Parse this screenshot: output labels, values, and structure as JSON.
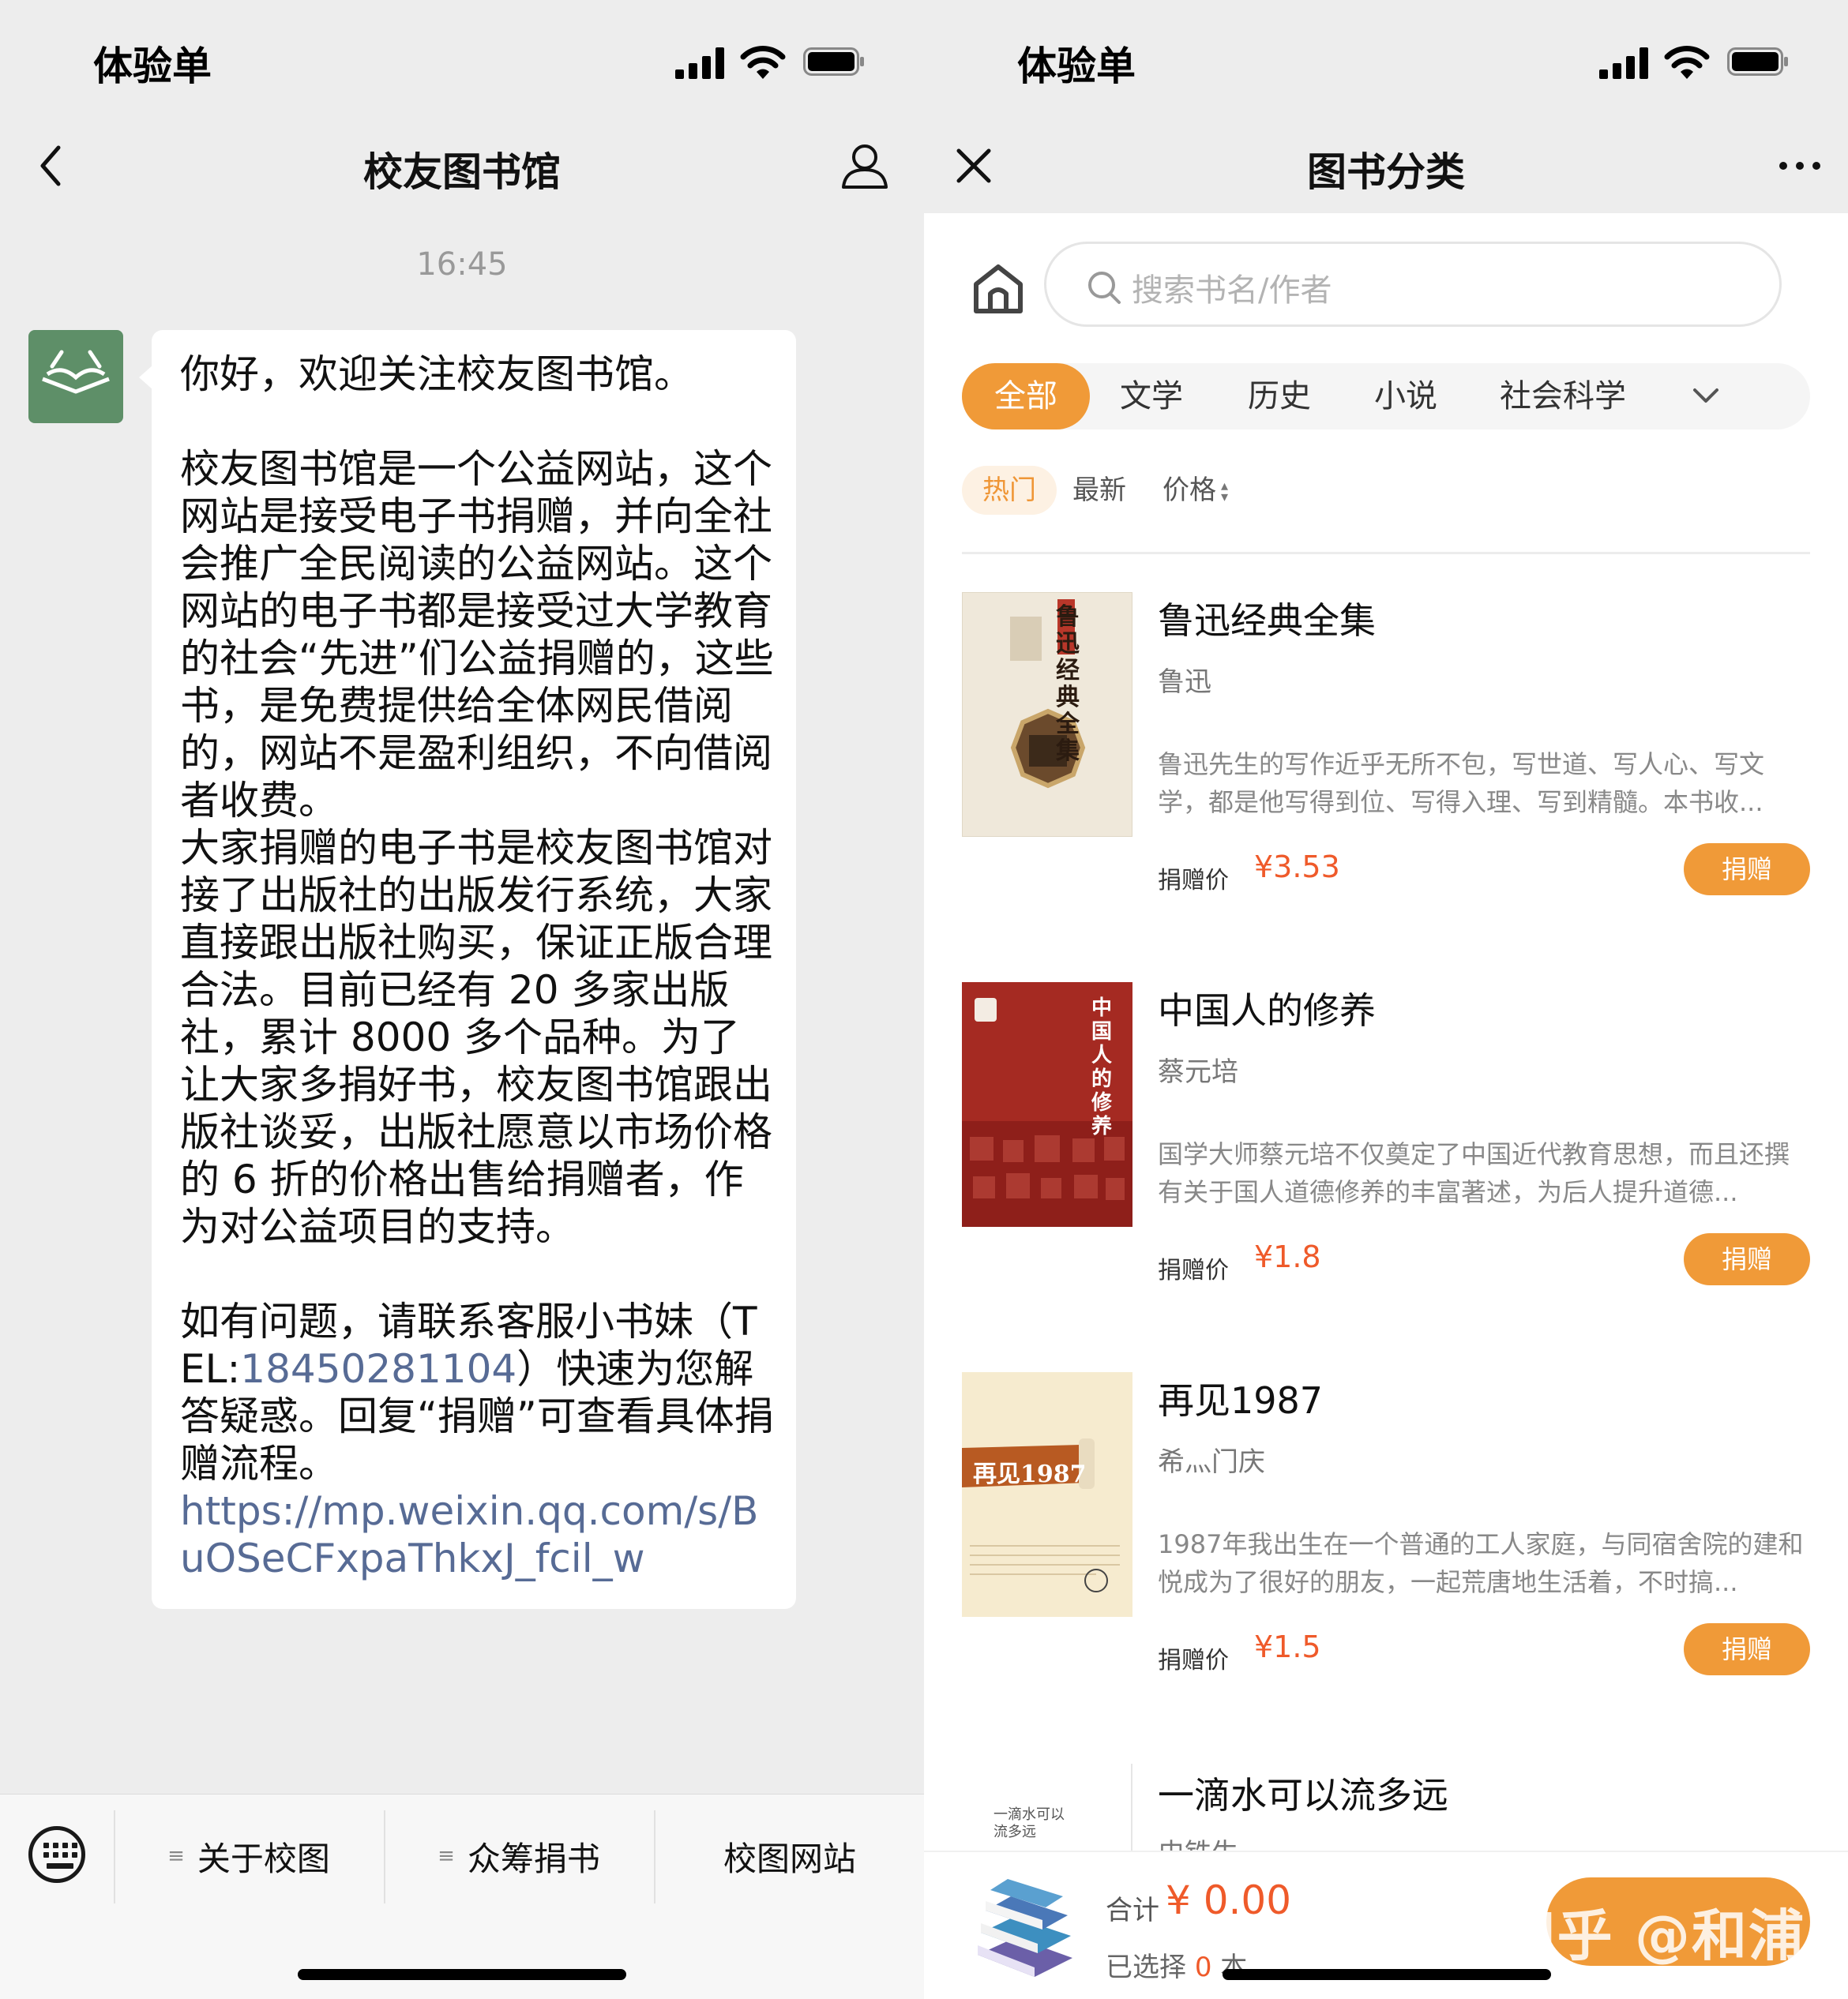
{
  "left": {
    "status": {
      "carrier": "体验单"
    },
    "nav": {
      "title": "校友图书馆"
    },
    "chat": {
      "timestamp": "16:45",
      "p1": "你好，欢迎关注校友图书馆。",
      "p2": "校友图书馆是一个公益网站，这个网站是接受电子书捐赠，并向全社会推广全民阅读的公益网站。这个网站的电子书都是接受过大学教育的社会“先进”们公益捐赠的，这些书，是免费提供给全体网民借阅的，网站不是盈利组织，不向借阅者收费。",
      "p3": "大家捐赠的电子书是校友图书馆对接了出版社的出版发行系统，大家直接跟出版社购买，保证正版合理合法。目前已经有 20 多家出版社，累计 8000 多个品种。为了让大家多捐好书，校友图书馆跟出版社谈妥，出版社愿意以市场价格的 6 折的价格出售给捐赠者，作为对公益项目的支持。",
      "p4_pre": "如有问题，请联系客服小书妹（TEL:",
      "tel": "18450281104",
      "p4_post": "）快速为您解答疑惑。回复“捐赠”可查看具体捐赠流程。",
      "link": "https://mp.weixin.qq.com/s/BuOSeCFxpaThkxJ_fcil_w"
    },
    "menu": {
      "items": [
        {
          "label": "关于校图",
          "has_menu": true
        },
        {
          "label": "众筹捐书",
          "has_menu": true
        },
        {
          "label": "校图网站",
          "has_menu": false
        }
      ],
      "menu_glyph": "≡"
    }
  },
  "right": {
    "status": {
      "carrier": "体验单"
    },
    "nav": {
      "title": "图书分类"
    },
    "search": {
      "placeholder": "搜索书名/作者"
    },
    "categories": [
      "全部",
      "文学",
      "历史",
      "小说",
      "社会科学"
    ],
    "active_category": "全部",
    "sorts": [
      "热门",
      "最新",
      "价格"
    ],
    "active_sort": "热门",
    "price_label": "捐赠价",
    "donate_label": "捐赠",
    "books": [
      {
        "title": "鲁迅经典全集",
        "author": "鲁迅",
        "desc": "鲁迅先生的写作近乎无所不包，写世道、写人心、写文学，都是他写得到位、写得入理、写到精髓。本书收...",
        "price": "¥3.53",
        "cover_text": "鲁迅经典全集"
      },
      {
        "title": "中国人的修养",
        "author": "蔡元培",
        "desc": "国学大师蔡元培不仅奠定了中国近代教育思想，而且还撰有关于国人道德修养的丰富著述，为后人提升道德...",
        "price": "¥1.8",
        "cover_text": "中国人的修养"
      },
      {
        "title": "再见1987",
        "author": "希灬门庆",
        "desc": "1987年我出生在一个普通的工人家庭，与同宿舍院的建和悦成为了很好的朋友，一起荒唐地生活着，不时搞...",
        "price": "¥1.5",
        "cover_text": "再见1987"
      },
      {
        "title": "一滴水可以流多远",
        "author": "史铁生",
        "cover_text": "一滴水可以流多远"
      }
    ],
    "cart": {
      "total_label": "合计",
      "total_value": "¥ 0.00",
      "selected_pre": "已选择",
      "selected_count": "0",
      "selected_post": "本",
      "watermark": "知乎 @和浦"
    },
    "colors": {
      "accent": "#f09a38",
      "price": "#ef5a2a",
      "link": "#576b95"
    }
  }
}
